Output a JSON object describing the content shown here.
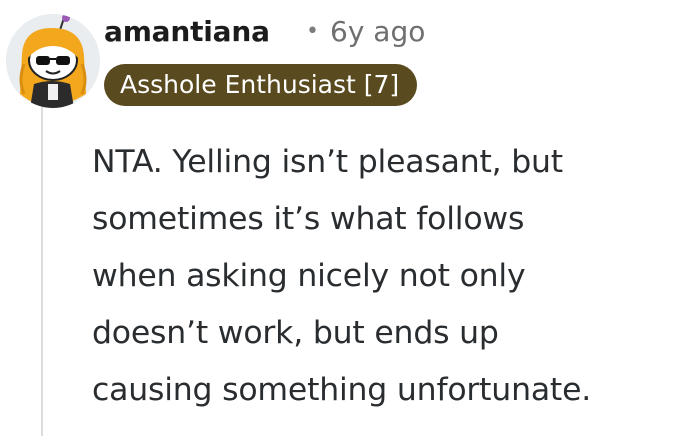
{
  "comment": {
    "username": "amantiana",
    "separator": "•",
    "timestamp": "6y ago",
    "flair": "Asshole Enthusiast [7]",
    "body_lines": [
      "NTA. Yelling isn’t pleasant, but",
      "sometimes it’s what follows",
      "when asking nicely not only",
      "doesn’t work, but ends up",
      "causing something unfortunate."
    ],
    "avatar_icon": "snoo-avatar-sunglasses-icon"
  },
  "colors": {
    "flair_background": "#5a4a1f",
    "flair_text": "#ffffff",
    "body_text": "#2a2d30",
    "username_text": "#1c1c1c",
    "meta_text": "#6f6f6f",
    "thread_line": "#dcdcdc"
  }
}
